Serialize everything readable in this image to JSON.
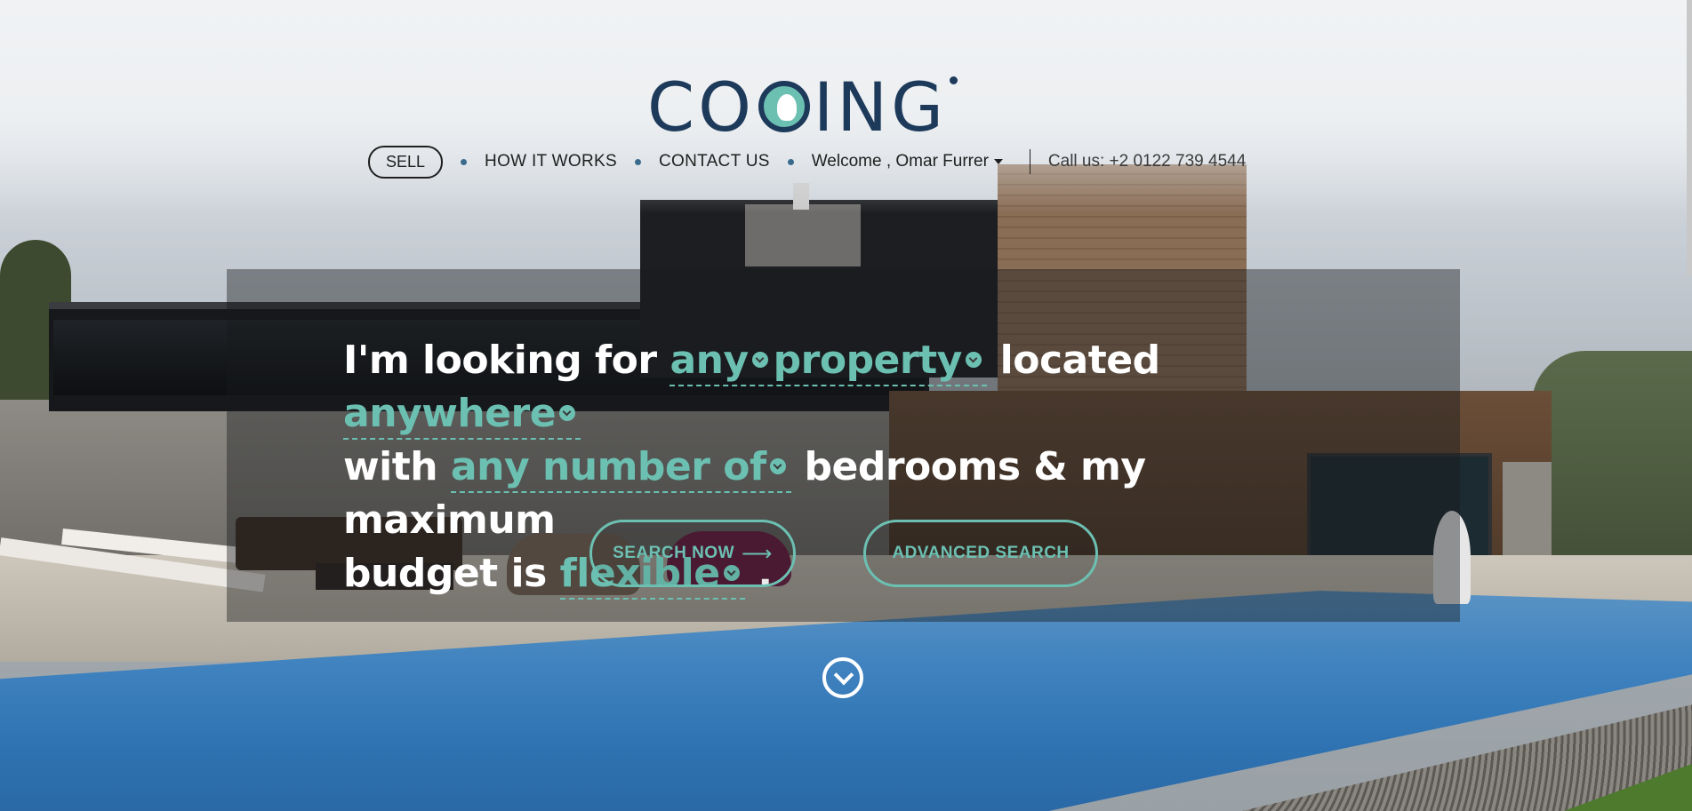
{
  "brand": {
    "name": "COOING"
  },
  "nav": {
    "sell": "SELL",
    "how_it_works": "HOW IT WORKS",
    "contact_us": "CONTACT US",
    "welcome": "Welcome , Omar Furrer",
    "call_us": "Call us: +2 0122 739 4544"
  },
  "search": {
    "t1": "I'm looking for",
    "type_any": "any",
    "property": "property",
    "located": "located",
    "location": "anywhere",
    "with": "with",
    "bedrooms_value": "any number of",
    "bedrooms_text": "bedrooms & my maximum",
    "budget_is": "budget is",
    "budget": "flexible",
    "period": "."
  },
  "buttons": {
    "search_now": "SEARCH NOW",
    "advanced_search": "ADVANCED SEARCH"
  },
  "colors": {
    "accent": "#6cc0b2",
    "brand": "#1d3a5b"
  },
  "icons": [
    "bird-logo-icon",
    "chevron-down-icon",
    "arrow-right-icon",
    "scroll-down-icon",
    "caret-down-icon"
  ]
}
